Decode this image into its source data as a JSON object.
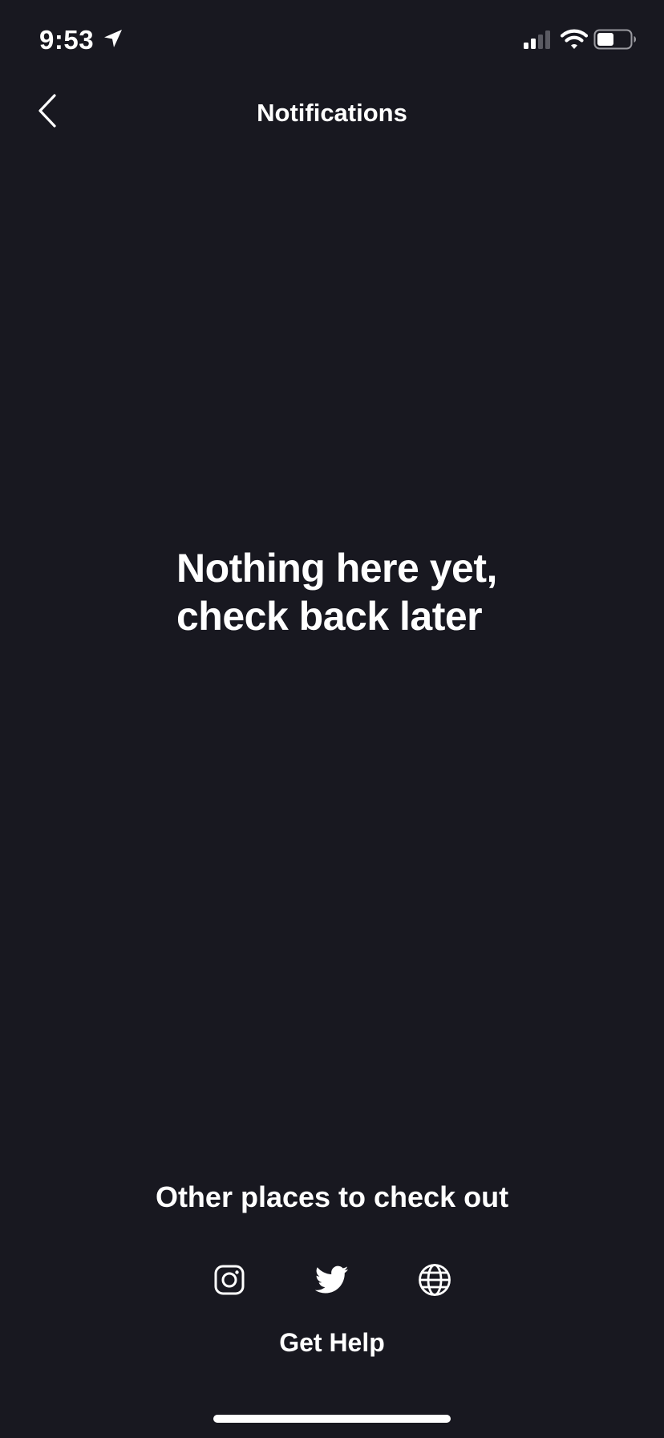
{
  "status_bar": {
    "time": "9:53",
    "icons": [
      "location-arrow-icon",
      "cellular-signal-icon",
      "wifi-icon",
      "battery-icon"
    ]
  },
  "header": {
    "title": "Notifications",
    "back_icon": "chevron-left-icon"
  },
  "empty_state": {
    "line1": "Nothing here yet,",
    "line2": "check back later"
  },
  "footer": {
    "heading": "Other places to check out",
    "links": [
      {
        "icon": "instagram-icon"
      },
      {
        "icon": "twitter-icon"
      },
      {
        "icon": "globe-icon"
      }
    ],
    "help_label": "Get Help"
  },
  "colors": {
    "background": "#181820",
    "text": "#ffffff"
  }
}
